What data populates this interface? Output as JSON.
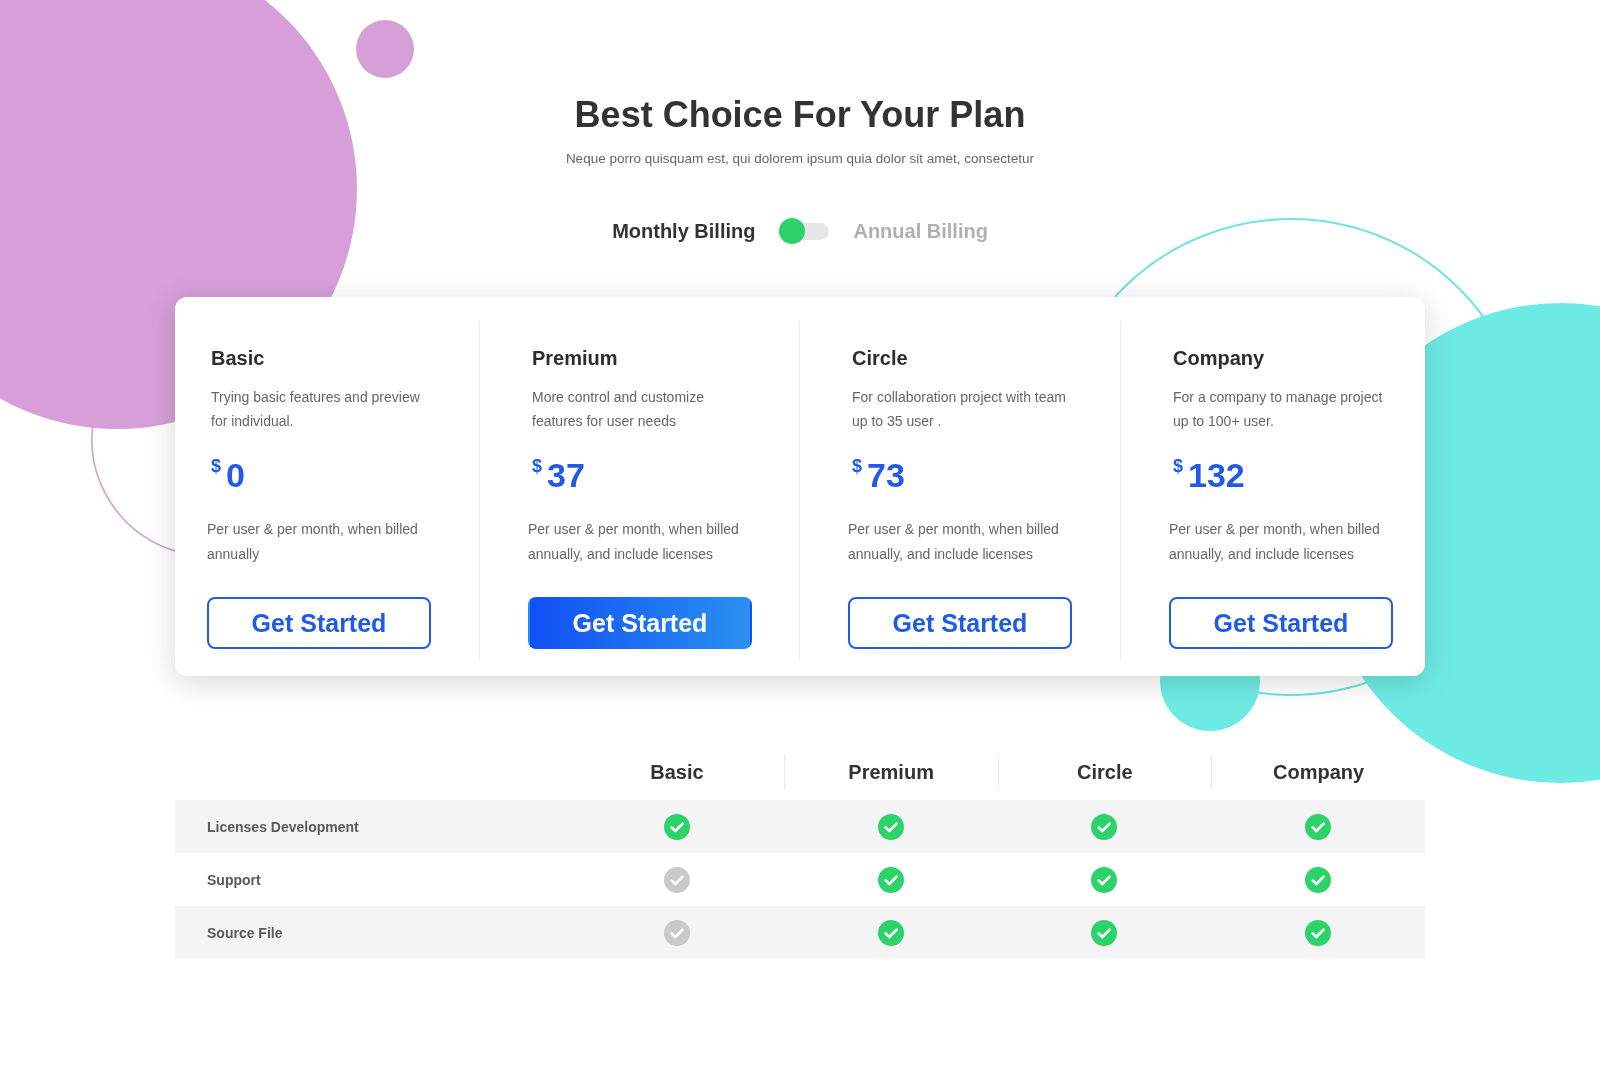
{
  "header": {
    "title": "Best Choice For Your Plan",
    "subtitle": "Neque porro quisquam est, qui dolorem ipsum quia dolor sit amet, consectetur"
  },
  "billing_toggle": {
    "options": [
      {
        "label": "Monthly Billing",
        "selected": true
      },
      {
        "label": "Annual Billing",
        "selected": false
      }
    ]
  },
  "plans": [
    {
      "name": "Basic",
      "description": "Trying basic features and preview for individual.",
      "currency": "$",
      "price": "0",
      "note": "Per user & per month, when billed annually",
      "button": {
        "label": "Get Started",
        "filled": false
      }
    },
    {
      "name": "Premium",
      "description": "More control and customize features for user needs",
      "currency": "$",
      "price": "37",
      "note": "Per user & per month, when billed annually, and include licenses",
      "button": {
        "label": "Get Started",
        "filled": true
      }
    },
    {
      "name": "Circle",
      "description": "For collaboration project with team up to 35 user .",
      "currency": "$",
      "price": "73",
      "note": "Per user & per month, when billed annually, and include licenses",
      "button": {
        "label": "Get Started",
        "filled": false
      }
    },
    {
      "name": "Company",
      "description": "For a company to manage project up to 100+ user.",
      "currency": "$",
      "price": "132",
      "note": "Per user & per month, when billed annually, and include licenses",
      "button": {
        "label": "Get Started",
        "filled": false
      }
    }
  ],
  "comparison": {
    "columns": [
      "Basic",
      "Premium",
      "Circle",
      "Company"
    ],
    "rows": [
      {
        "feature": "Licenses Development",
        "included": [
          true,
          true,
          true,
          true
        ]
      },
      {
        "feature": "Support",
        "included": [
          false,
          true,
          true,
          true
        ]
      },
      {
        "feature": "Source File",
        "included": [
          false,
          true,
          true,
          true
        ]
      }
    ]
  }
}
